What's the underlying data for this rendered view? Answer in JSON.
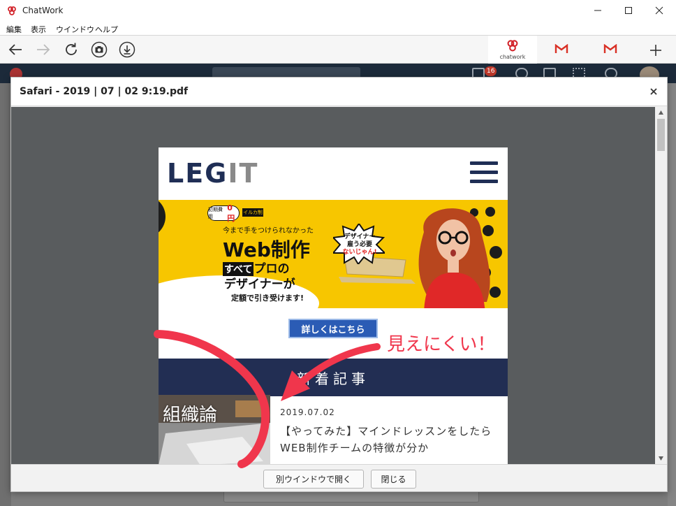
{
  "window": {
    "title": "ChatWork",
    "controls": [
      "minimize-icon",
      "maximize-icon",
      "close-icon"
    ]
  },
  "menu": {
    "items": [
      "編集",
      "表示",
      "ウインドウ",
      "ヘルプ"
    ]
  },
  "toolbar": {
    "services": [
      {
        "name": "chatwork",
        "label": "chatwork",
        "active": true
      },
      {
        "name": "gmail-1",
        "label": "",
        "active": false
      },
      {
        "name": "gmail-2",
        "label": "",
        "active": false
      }
    ],
    "add_label": "+"
  },
  "background_app": {
    "notification_count": "16"
  },
  "modal": {
    "title": "Safari - 2019 | 07 | 02 9:19.pdf",
    "close_label": "×",
    "footer": {
      "open_window_label": "別ウインドウで開く",
      "close_label": "閉じる"
    }
  },
  "pdf": {
    "logo_part1": "LEG",
    "logo_part2": "IT",
    "banner": {
      "badge_small": "初期費用",
      "badge_price": "0円",
      "tag": "イルカ制作所",
      "subtitle": "今まで手をつけられなかった",
      "headline": "Web制作",
      "line3_box": "すべて",
      "line3_rest": "プロの",
      "line4": "デザイナーが",
      "line5": "定額で引き受けます!",
      "burst_line1": "デザイナー",
      "burst_line2": "雇う必要",
      "burst_line3": "ないじゃん!"
    },
    "detail_button": "詳しくはこちら",
    "section_title": "新着記事",
    "post": {
      "thumb_label": "組織論",
      "date": "2019.07.02",
      "title": "【やってみた】マインドレッスンをしたらWEB制作チームの特徴が分か"
    }
  },
  "annotation": {
    "text": "見えにくい！",
    "color": "#f0364c"
  },
  "colors": {
    "navy": "#222e53",
    "banner_yellow": "#f7c600",
    "viewer_bg": "#595c5e",
    "button_blue": "#2b5cb5"
  }
}
